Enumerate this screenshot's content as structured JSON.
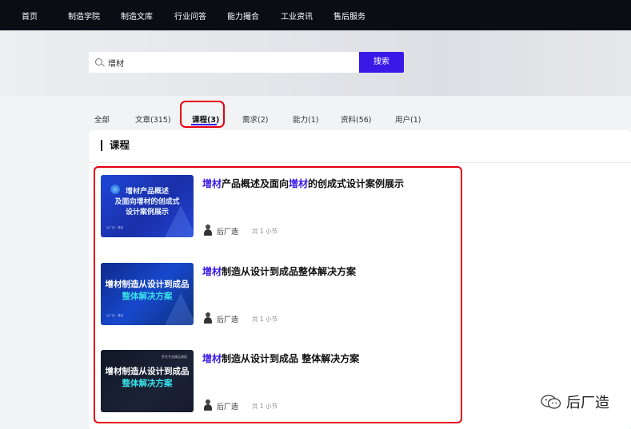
{
  "nav": {
    "items": [
      "首页",
      "制造学院",
      "制造文库",
      "行业问答",
      "能力撮合",
      "工业资讯",
      "售后服务"
    ]
  },
  "search": {
    "value": "增材",
    "button_label": "搜索"
  },
  "tabs": [
    {
      "label": "全部"
    },
    {
      "label": "文章(315)"
    },
    {
      "label": "课程(3)",
      "active": true
    },
    {
      "label": "需求(2)"
    },
    {
      "label": "能力(1)"
    },
    {
      "label": "资料(56)"
    },
    {
      "label": "用户(1)"
    }
  ],
  "section_title": "课程",
  "courses": [
    {
      "thumb_title": "增材产品概述\n及面向增材的创成式\n设计案例展示",
      "thumb_footer": "后厂造 · 课程",
      "title_kw1": "增材",
      "title_mid": "产品概述及面向",
      "title_kw2": "增材",
      "title_end": "的创成式设计案例展示",
      "author": "后厂造",
      "sections": "共 1 小节"
    },
    {
      "thumb_line1": "增材制造从设计到成品",
      "thumb_line2": "整体解决方案",
      "thumb_footer": "后厂造 · 课程",
      "title_kw1": "增材",
      "title_end": "制造从设计到成品整体解决方案",
      "author": "后厂造",
      "sections": "共 1 小节"
    },
    {
      "thumb_line1": "增材制造从设计到成品",
      "thumb_line2": "整体解决方案",
      "thumb_top": "罗艺专业精品课程",
      "title_kw1": "增材",
      "title_end": "制造从设计到成品 整体解决方案",
      "author": "后厂造",
      "sections": "共 1 小节"
    }
  ],
  "watermark": {
    "text": "后厂造",
    "icon": "wechat-icon"
  },
  "colors": {
    "accent": "#3a18e8",
    "highlight_border": "#e60012",
    "nav_bg": "#0b0d14"
  }
}
